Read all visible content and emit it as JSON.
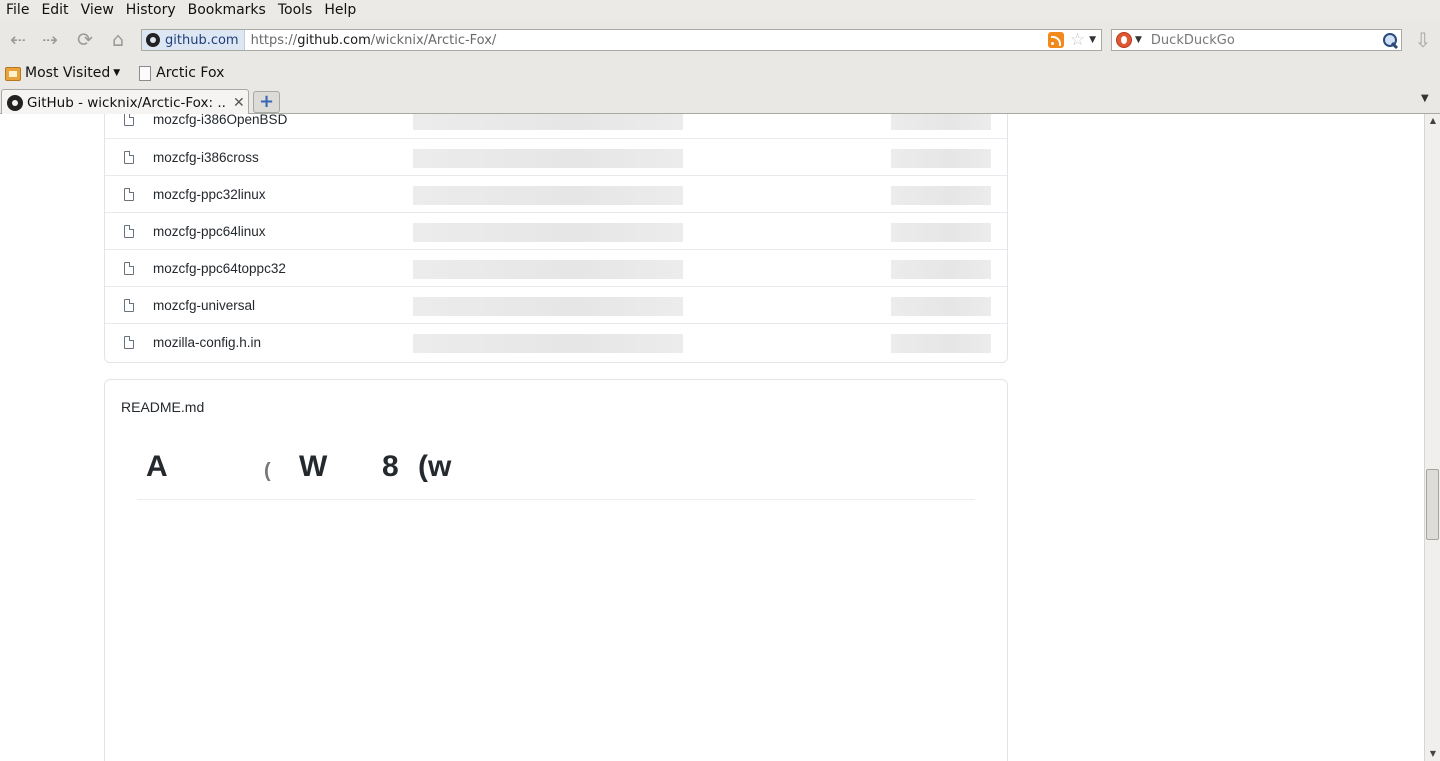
{
  "menubar": {
    "items": [
      "File",
      "Edit",
      "View",
      "History",
      "Bookmarks",
      "Tools",
      "Help"
    ]
  },
  "navbar": {
    "identity": "github.com",
    "url_prefix": "https://",
    "url_host": "github.com",
    "url_path": "/wicknix/Arctic-Fox/",
    "search_placeholder": "DuckDuckGo"
  },
  "bookmarks": {
    "most_visited": "Most Visited",
    "arctic_fox": "Arctic Fox"
  },
  "tabs": {
    "active_title": "GitHub - wicknix/Arctic-Fox: ...",
    "new_tab": "+"
  },
  "files": {
    "rows": [
      {
        "name": "mozcfg-i386OpenBSD"
      },
      {
        "name": "mozcfg-i386cross"
      },
      {
        "name": "mozcfg-ppc32linux"
      },
      {
        "name": "mozcfg-ppc64linux"
      },
      {
        "name": "mozcfg-ppc64toppc32"
      },
      {
        "name": "mozcfg-universal"
      },
      {
        "name": "mozilla-config.h.in"
      }
    ]
  },
  "readme": {
    "title": "README.md",
    "heading_fragments": [
      "A",
      "(",
      "W",
      "8",
      "(w"
    ]
  },
  "icons": {
    "back": "back-arrow-icon",
    "forward": "forward-arrow-icon",
    "reload": "reload-icon",
    "home": "home-icon",
    "rss": "rss-feed-icon",
    "star": "bookmark-star-icon",
    "search_engine": "duckduckgo-icon",
    "search": "magnifier-icon",
    "downloads": "download-icon",
    "file": "file-icon"
  },
  "colors": {
    "chrome": "#e9e8e4",
    "border": "#e1e4e8",
    "skeleton": "#ececec",
    "text": "#24292e"
  }
}
